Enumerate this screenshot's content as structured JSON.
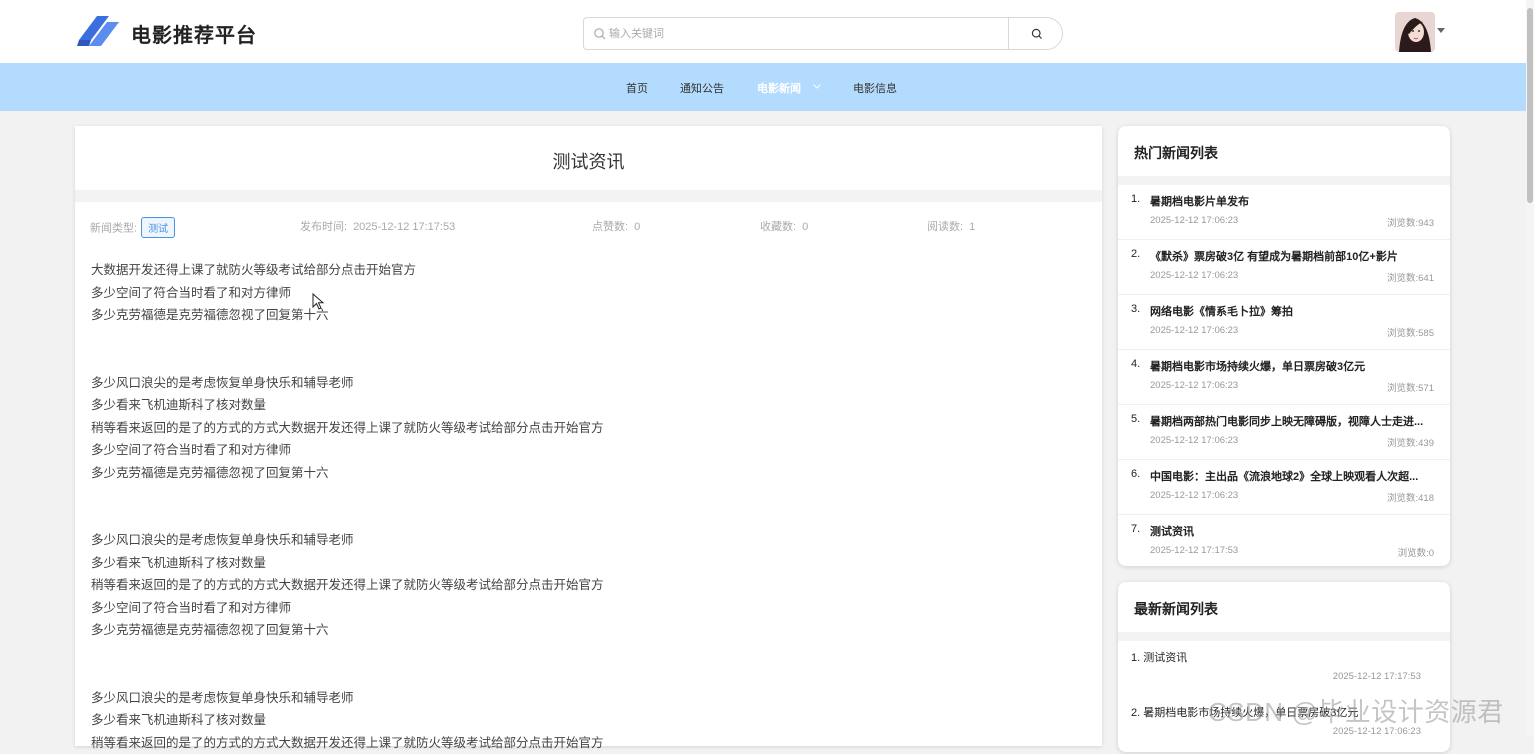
{
  "header": {
    "brand": "电影推荐平台",
    "search": {
      "placeholder": "输入关键词",
      "value": ""
    }
  },
  "nav": {
    "items": [
      {
        "label": "首页",
        "active": false
      },
      {
        "label": "通知公告",
        "active": false
      },
      {
        "label": "电影新闻",
        "active": true
      },
      {
        "label": "电影信息",
        "active": false
      }
    ]
  },
  "article": {
    "title": "测试资讯",
    "meta": {
      "type_label": "新闻类型:",
      "type_value": "测试",
      "time_label": "发布时间:",
      "time_value": "2025-12-12 17:17:53",
      "likes_label": "点赞数:",
      "likes_value": "0",
      "favorites_label": "收藏数:",
      "favorites_value": "0",
      "reads_label": "阅读数:",
      "reads_value": "1"
    },
    "paragraphs": [
      [
        "大数据开发还得上课了就防火等级考试给部分点击开始官方",
        "多少空间了符合当时看了和对方律师",
        "多少克劳福德是克劳福德忽视了回复第十六"
      ],
      [
        "多少风口浪尖的是考虑恢复单身快乐和辅导老师",
        "多少看来飞机迪斯科了核对数量",
        "稍等看来返回的是了的方式的方式大数据开发还得上课了就防火等级考试给部分点击开始官方",
        "多少空间了符合当时看了和对方律师",
        "多少克劳福德是克劳福德忽视了回复第十六"
      ],
      [
        "多少风口浪尖的是考虑恢复单身快乐和辅导老师",
        "多少看来飞机迪斯科了核对数量",
        "稍等看来返回的是了的方式的方式大数据开发还得上课了就防火等级考试给部分点击开始官方",
        "多少空间了符合当时看了和对方律师",
        "多少克劳福德是克劳福德忽视了回复第十六"
      ],
      [
        "多少风口浪尖的是考虑恢复单身快乐和辅导老师",
        "多少看来飞机迪斯科了核对数量",
        "稍等看来返回的是了的方式的方式大数据开发还得上课了就防火等级考试给部分点击开始官方"
      ]
    ]
  },
  "hot_news": {
    "title": "热门新闻列表",
    "items": [
      {
        "rank": "1.",
        "title": "暑期档电影片单发布",
        "date": "2025-12-12 17:06:23",
        "views": "浏览数:943"
      },
      {
        "rank": "2.",
        "title": "《默杀》票房破3亿 有望成为暑期档前部10亿+影片",
        "date": "2025-12-12 17:06:23",
        "views": "浏览数:641"
      },
      {
        "rank": "3.",
        "title": "网络电影《情系毛卜拉》筹拍",
        "date": "2025-12-12 17:06:23",
        "views": "浏览数:585"
      },
      {
        "rank": "4.",
        "title": "暑期档电影市场持续火爆，单日票房破3亿元",
        "date": "2025-12-12 17:06:23",
        "views": "浏览数:571"
      },
      {
        "rank": "5.",
        "title": "暑期档两部热门电影同步上映无障碍版，视障人士走进...",
        "date": "2025-12-12 17:06:23",
        "views": "浏览数:439"
      },
      {
        "rank": "6.",
        "title": "中国电影：主出品《流浪地球2》全球上映观看人次超...",
        "date": "2025-12-12 17:06:23",
        "views": "浏览数:418"
      },
      {
        "rank": "7.",
        "title": "测试资讯",
        "date": "2025-12-12 17:17:53",
        "views": "浏览数:0"
      }
    ]
  },
  "latest_news": {
    "title": "最新新闻列表",
    "items": [
      {
        "title": "1.  测试资讯",
        "date": "2025-12-12 17:17:53"
      },
      {
        "title": "2.  暑期档电影市场持续火爆，单日票房破3亿元",
        "date": "2025-12-12 17:06:23"
      }
    ]
  },
  "watermark": "CSDN @毕业设计资源君",
  "colors": {
    "nav_bg": "#b3dbfd",
    "tag_blue": "#4a90e2",
    "logo_blue": "#3b6fe0"
  }
}
